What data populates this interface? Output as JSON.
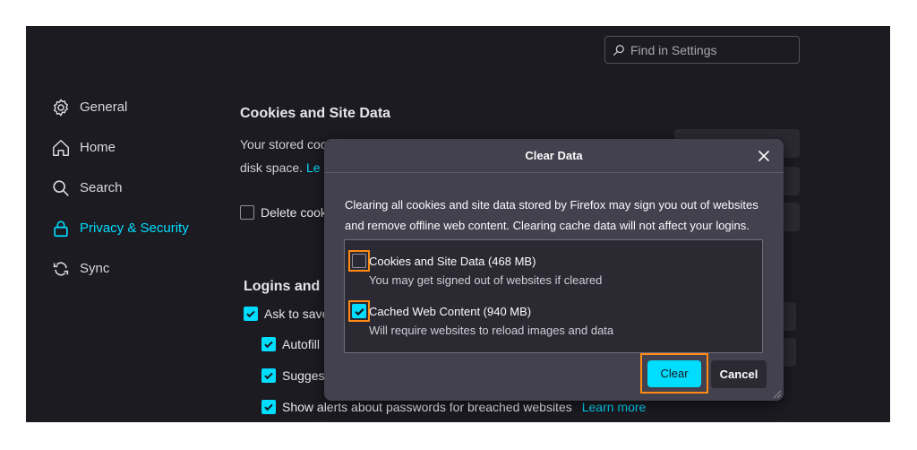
{
  "search": {
    "placeholder": "Find in Settings"
  },
  "sidebar": {
    "items": [
      {
        "label": "General",
        "icon": "gear-icon"
      },
      {
        "label": "Home",
        "icon": "home-icon"
      },
      {
        "label": "Search",
        "icon": "search-icon"
      },
      {
        "label": "Privacy & Security",
        "icon": "lock-icon",
        "active": true
      },
      {
        "label": "Sync",
        "icon": "sync-icon"
      }
    ]
  },
  "main": {
    "cookies_section": {
      "title": "Cookies and Site Data",
      "text_line1": "Your stored coo",
      "text_line2": "disk space.",
      "learn_more": "Le",
      "delete_label": "Delete cook"
    },
    "logins_section": {
      "title": "Logins and P",
      "ask_to_save": "Ask to save",
      "autofill": "Autofill",
      "suggest": "Suggest",
      "breach_alerts": "Show alerts about passwords for breached websites",
      "learn_more": "Learn more"
    }
  },
  "dialog": {
    "title": "Clear Data",
    "description": "Clearing all cookies and site data stored by Firefox may sign you out of websites and remove offline web content. Clearing cache data will not affect your logins.",
    "options": [
      {
        "label": "Cookies and Site Data (468 MB)",
        "sublabel": "You may get signed out of websites if cleared",
        "checked": false
      },
      {
        "label": "Cached Web Content (940 MB)",
        "sublabel": "Will require websites to reload images and data",
        "checked": true
      }
    ],
    "clear_label": "Clear",
    "cancel_label": "Cancel"
  },
  "colors": {
    "accent": "#00ddff",
    "highlight": "#ff8a16",
    "background": "#1c1b22",
    "dialog": "#42414d"
  }
}
